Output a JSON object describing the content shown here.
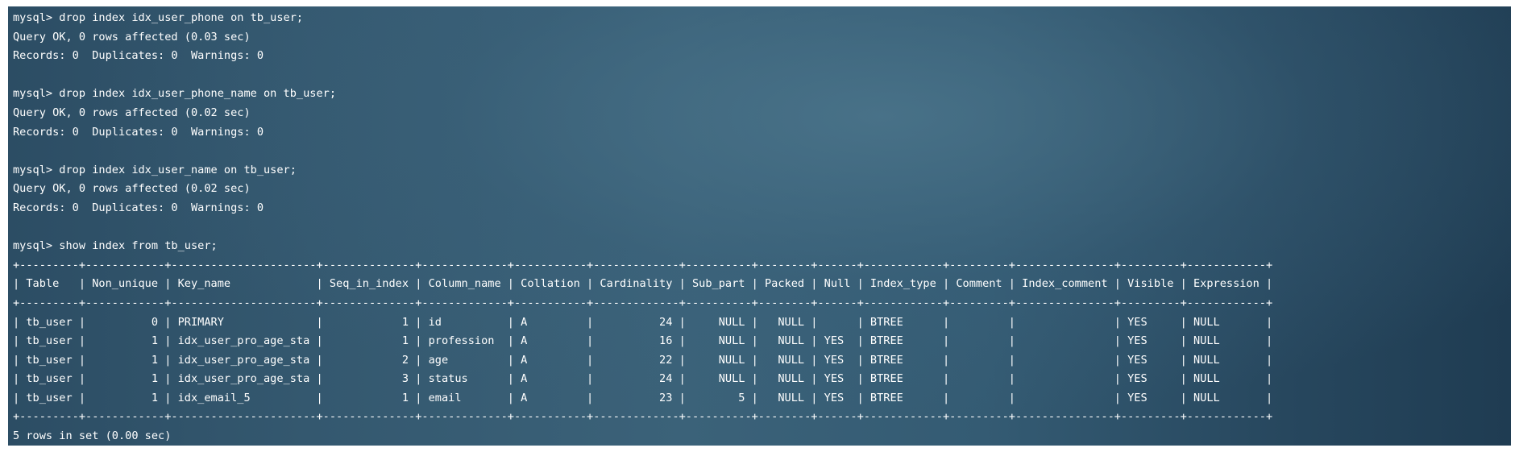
{
  "terminal": {
    "lines": [
      "mysql> drop index idx_user_phone on tb_user;",
      "Query OK, 0 rows affected (0.03 sec)",
      "Records: 0  Duplicates: 0  Warnings: 0",
      "",
      "mysql> drop index idx_user_phone_name on tb_user;",
      "Query OK, 0 rows affected (0.02 sec)",
      "Records: 0  Duplicates: 0  Warnings: 0",
      "",
      "mysql> drop index idx_user_name on tb_user;",
      "Query OK, 0 rows affected (0.02 sec)",
      "Records: 0  Duplicates: 0  Warnings: 0",
      "",
      "mysql> show index from tb_user;",
      "+---------+------------+----------------------+--------------+-------------+-----------+-------------+----------+--------+------+------------+---------+---------------+---------+------------+",
      "| Table   | Non_unique | Key_name             | Seq_in_index | Column_name | Collation | Cardinality | Sub_part | Packed | Null | Index_type | Comment | Index_comment | Visible | Expression |",
      "+---------+------------+----------------------+--------------+-------------+-----------+-------------+----------+--------+------+------------+---------+---------------+---------+------------+",
      "| tb_user |          0 | PRIMARY              |            1 | id          | A         |          24 |     NULL |   NULL |      | BTREE      |         |               | YES     | NULL       |",
      "| tb_user |          1 | idx_user_pro_age_sta |            1 | profession  | A         |          16 |     NULL |   NULL | YES  | BTREE      |         |               | YES     | NULL       |",
      "| tb_user |          1 | idx_user_pro_age_sta |            2 | age         | A         |          22 |     NULL |   NULL | YES  | BTREE      |         |               | YES     | NULL       |",
      "| tb_user |          1 | idx_user_pro_age_sta |            3 | status      | A         |          24 |     NULL |   NULL | YES  | BTREE      |         |               | YES     | NULL       |",
      "| tb_user |          1 | idx_email_5          |            1 | email       | A         |          23 |        5 |   NULL | YES  | BTREE      |         |               | YES     | NULL       |",
      "+---------+------------+----------------------+--------------+-------------+-----------+-------------+----------+--------+------+------------+---------+---------------+---------+------------+",
      "5 rows in set (0.00 sec)"
    ]
  }
}
